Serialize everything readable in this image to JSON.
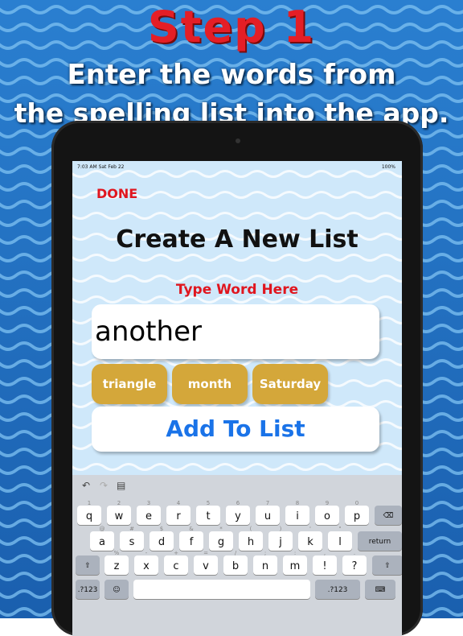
{
  "header": {
    "step": "Step 1",
    "line1": "Enter the words from",
    "line2": "the spelling list into the app."
  },
  "status_bar": {
    "time": "7:03 AM  Sat Feb 22",
    "battery": "100%"
  },
  "app": {
    "done_label": "DONE",
    "title": "Create A New List",
    "prompt": "Type Word Here",
    "input_value": "another",
    "suggestions": [
      "triangle",
      "month",
      "Saturday"
    ],
    "add_button": "Add To List"
  },
  "keyboard": {
    "row1": [
      "q",
      "w",
      "e",
      "r",
      "t",
      "y",
      "u",
      "i",
      "o",
      "p"
    ],
    "row1_alt": [
      "1",
      "2",
      "3",
      "4",
      "5",
      "6",
      "7",
      "8",
      "9",
      "0"
    ],
    "row2": [
      "a",
      "s",
      "d",
      "f",
      "g",
      "h",
      "j",
      "k",
      "l"
    ],
    "row2_alt": [
      "@",
      "#",
      "$",
      "&",
      "*",
      "(",
      ")",
      "'",
      "\""
    ],
    "row3": [
      "z",
      "x",
      "c",
      "v",
      "b",
      "n",
      "m",
      "!",
      "?"
    ],
    "row3_alt": [
      "%",
      "-",
      "+",
      "=",
      "/",
      ";",
      ":",
      ",",
      "."
    ],
    "return_label": "return",
    "numbers_label": ".?123",
    "toolbar_icons": [
      "undo-icon",
      "redo-icon",
      "paste-icon"
    ]
  },
  "colors": {
    "accent_red": "#e0161f",
    "chip_gold": "#d4a73a",
    "button_blue": "#1a73e8"
  }
}
